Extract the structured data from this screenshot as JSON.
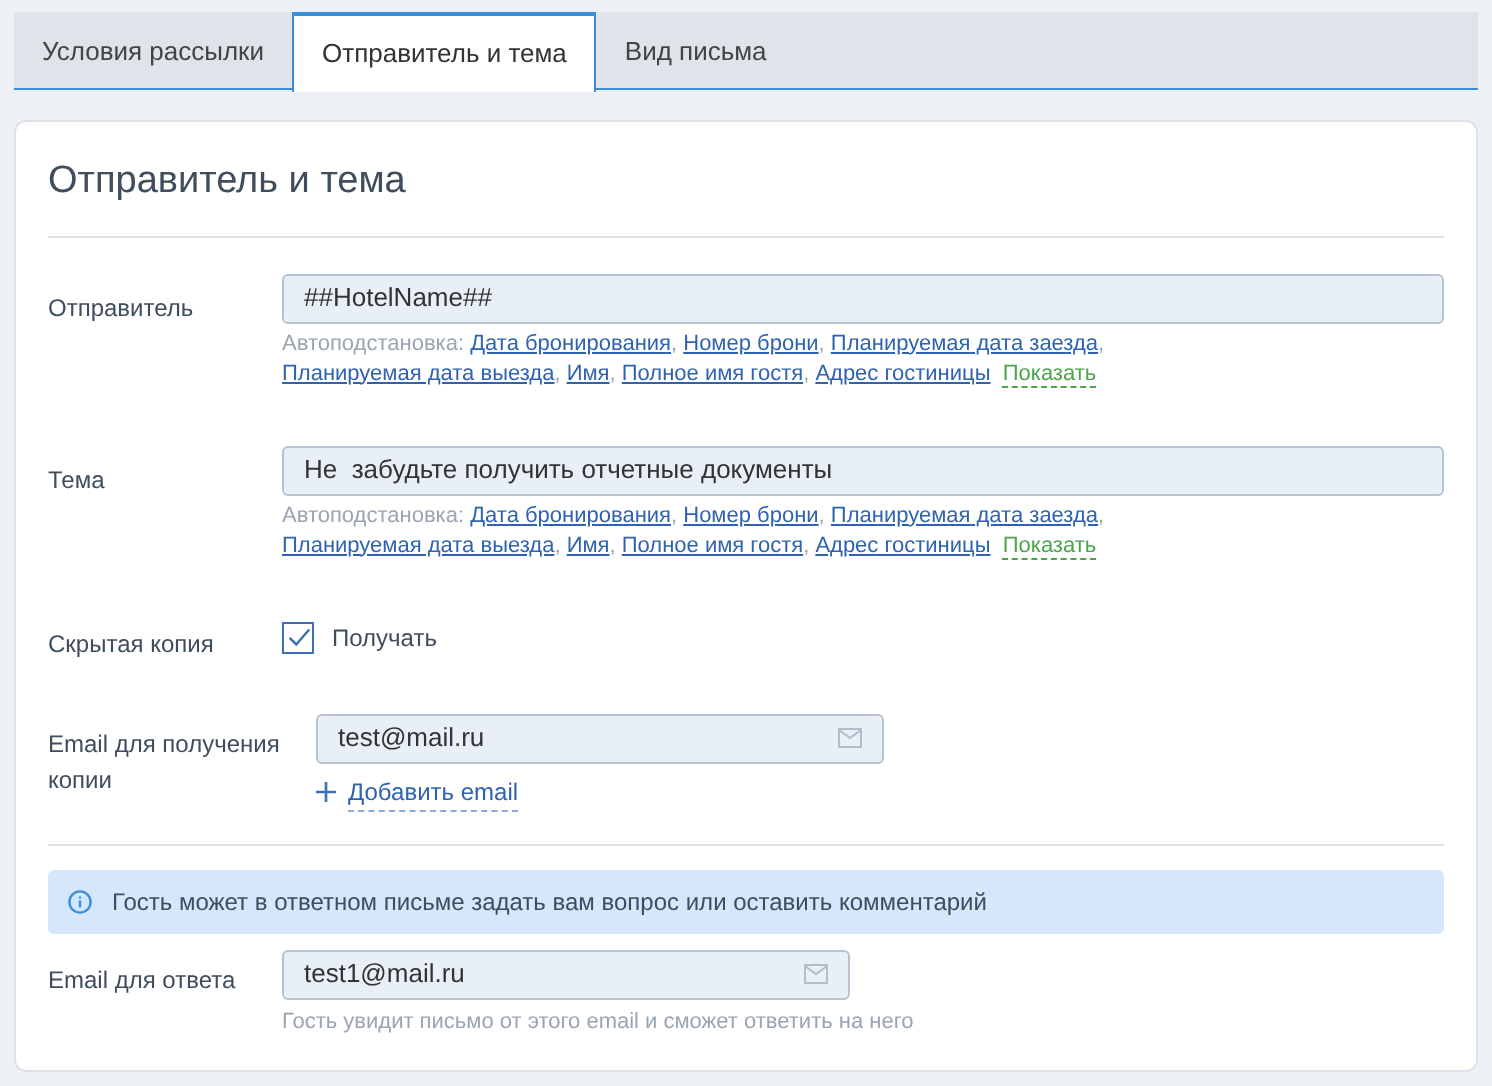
{
  "tabs": [
    {
      "label": "Условия рассылки",
      "selected": false
    },
    {
      "label": "Отправитель и тема",
      "selected": true
    },
    {
      "label": "Вид письма",
      "selected": false
    }
  ],
  "section_title": "Отправитель и тема",
  "sender": {
    "label": "Отправитель",
    "value": "##HotelName##",
    "autofill": {
      "prefix": "Автоподстановка:",
      "separator": ",",
      "links": [
        "Дата бронирования",
        "Номер брони",
        "Планируемая дата заезда",
        "Планируемая дата выезда",
        "Имя",
        "Полное имя гостя",
        "Адрес гостиницы"
      ],
      "toggle": "Показать"
    }
  },
  "subject": {
    "label": "Тема",
    "value": "Не  забудьте получить отчетные документы",
    "autofill": {
      "prefix": "Автоподстановка:",
      "separator": ",",
      "links": [
        "Дата бронирования",
        "Номер брони",
        "Планируемая дата заезда",
        "Планируемая дата выезда",
        "Имя",
        "Полное имя гостя",
        "Адрес гостиницы"
      ],
      "toggle": "Показать"
    }
  },
  "bcc": {
    "label": "Скрытая копия",
    "option": "Получать",
    "checked": true
  },
  "copy_email": {
    "label": "Email для получения копии",
    "value": "test@mail.ru",
    "add_link": "Добавить email"
  },
  "info": "Гость может в ответном письме задать вам вопрос или оставить комментарий",
  "reply_email": {
    "label": "Email для ответа",
    "value": "test1@mail.ru",
    "hint": "Гость увидит письмо от этого email и сможет ответить на него"
  }
}
